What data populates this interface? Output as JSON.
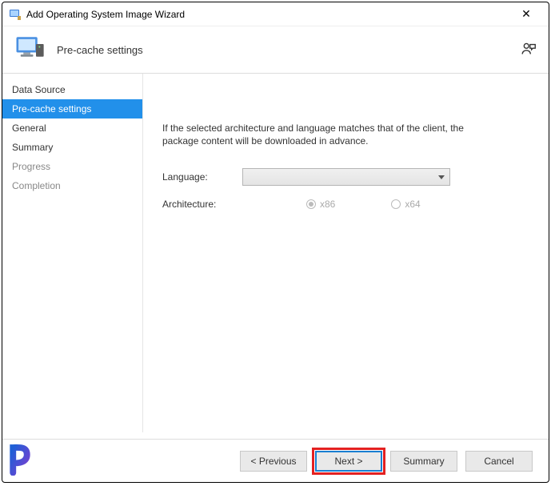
{
  "titlebar": {
    "title": "Add Operating System Image Wizard"
  },
  "header": {
    "title": "Pre-cache settings"
  },
  "sidebar": {
    "items": [
      {
        "label": "Data Source"
      },
      {
        "label": "Pre-cache settings"
      },
      {
        "label": "General"
      },
      {
        "label": "Summary"
      },
      {
        "label": "Progress"
      },
      {
        "label": "Completion"
      }
    ]
  },
  "content": {
    "description": "If the selected architecture and language matches that of the client, the package content will be downloaded in advance.",
    "language_label": "Language:",
    "architecture_label": "Architecture:",
    "arch_x86": "x86",
    "arch_x64": "x64"
  },
  "footer": {
    "previous": "< Previous",
    "next": "Next >",
    "summary": "Summary",
    "cancel": "Cancel"
  }
}
